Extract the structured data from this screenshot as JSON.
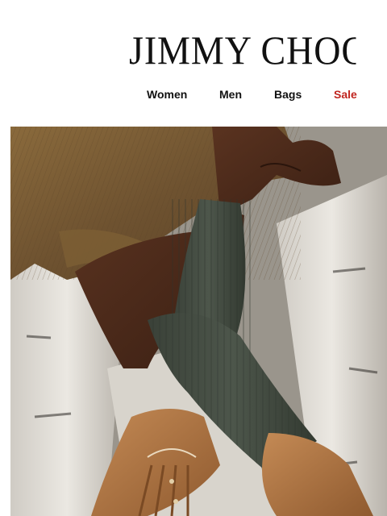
{
  "brand": {
    "logo_text": "JIMMY CHOO"
  },
  "nav": {
    "items": [
      {
        "label": "Women"
      },
      {
        "label": "Men"
      },
      {
        "label": "Bags"
      },
      {
        "label": "Sale"
      }
    ]
  },
  "colors": {
    "sale": "#c0251f",
    "text": "#111111",
    "background": "#ffffff"
  }
}
